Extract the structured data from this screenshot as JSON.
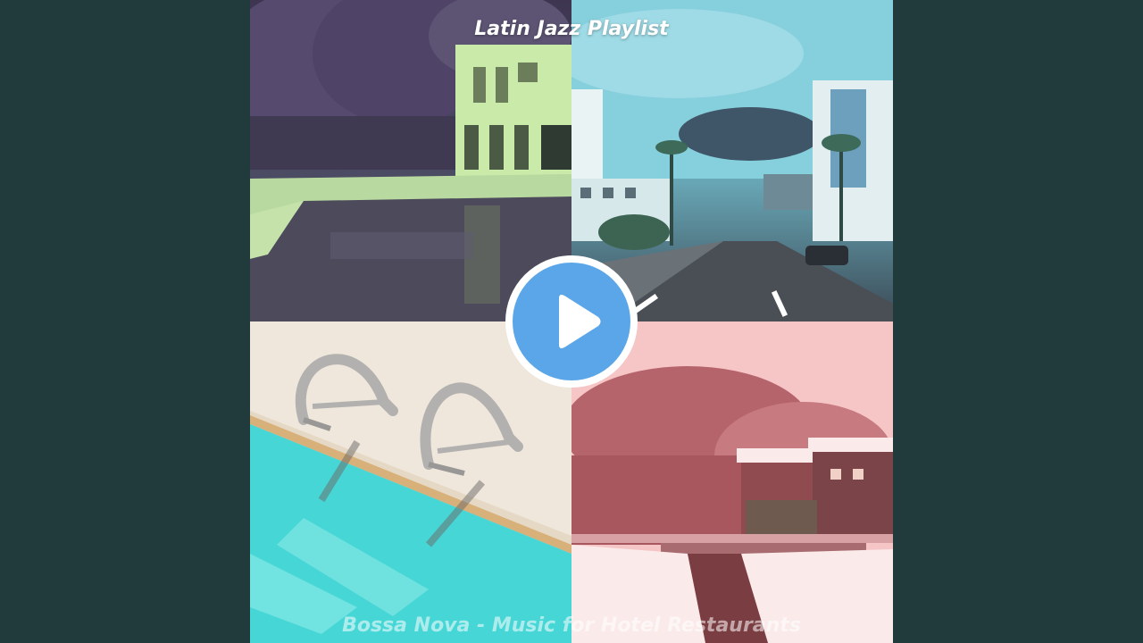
{
  "video": {
    "top_title": "Latin Jazz Playlist",
    "bottom_title": "Bossa Nova - Music for Hotel Restaurants"
  },
  "player": {
    "play_icon": "play-icon",
    "accent_color": "#5aa6e8"
  },
  "artwork": {
    "panels": [
      "pool-building",
      "city-street",
      "pool-ladder",
      "snowy-village"
    ]
  },
  "colors": {
    "background": "#213a3c"
  }
}
